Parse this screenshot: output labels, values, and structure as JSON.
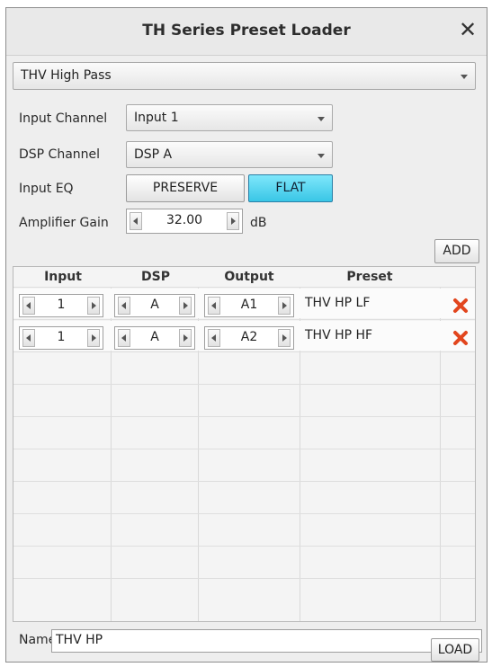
{
  "window": {
    "title": "TH Series Preset Loader",
    "close_glyph": "✕"
  },
  "preset_dropdown": {
    "value": "THV High Pass"
  },
  "fields": {
    "input_channel": {
      "label": "Input Channel",
      "value": "Input 1"
    },
    "dsp_channel": {
      "label": "DSP Channel",
      "value": "DSP A"
    },
    "input_eq": {
      "label": "Input EQ",
      "options": [
        "PRESERVE",
        "FLAT"
      ],
      "selected": "FLAT"
    },
    "amp_gain": {
      "label": "Amplifier Gain",
      "value": "32.00",
      "unit": "dB"
    }
  },
  "add_button": "ADD",
  "table": {
    "headers": [
      "Input",
      "DSP",
      "Output",
      "Preset"
    ],
    "rows": [
      {
        "input": "1",
        "dsp": "A",
        "output": "A1",
        "preset": "THV HP LF"
      },
      {
        "input": "1",
        "dsp": "A",
        "output": "A2",
        "preset": "THV HP HF"
      }
    ],
    "delete_icon": "red-x-icon",
    "delete_color": "#e2461e"
  },
  "name": {
    "label": "Name",
    "value": "THV HP"
  },
  "load_button": "LOAD",
  "colors": {
    "accent": "#39c6e6",
    "window_bg": "#eeeeee"
  }
}
